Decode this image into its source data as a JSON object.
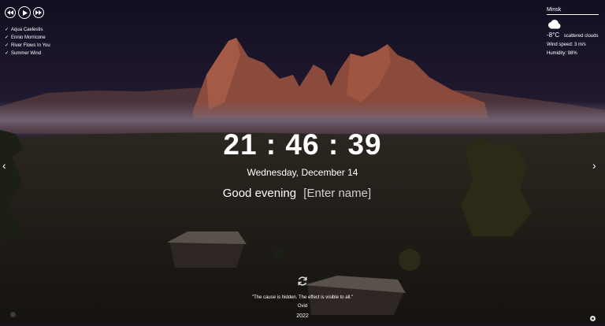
{
  "player": {
    "controls": [
      {
        "name": "previous-button",
        "icon": "skip-back-icon"
      },
      {
        "name": "play-button",
        "icon": "play-icon"
      },
      {
        "name": "next-button",
        "icon": "skip-forward-icon"
      }
    ],
    "check_mark": "✓",
    "playlist": [
      "Aqua Caelestis",
      "Ennio Morricone",
      "River Flows In You",
      "Summer Wind"
    ]
  },
  "weather": {
    "city": "Minsk",
    "icon": "scattered-clouds-icon",
    "temperature": "-8°C",
    "description": "scattered clouds",
    "wind": "Wind speed: 3 m/s",
    "humidity": "Humidity: 98%"
  },
  "clock": {
    "time": "21 : 46 : 39",
    "date": "Wednesday, December 14"
  },
  "greeting": {
    "text": "Good evening",
    "name_placeholder": "[Enter name]"
  },
  "slider": {
    "prev": "‹",
    "next": "›"
  },
  "quote": {
    "text": "\"The cause is hidden. The effect is visible to all.\"",
    "author": "Ovid"
  },
  "footer": {
    "year": "2022"
  }
}
